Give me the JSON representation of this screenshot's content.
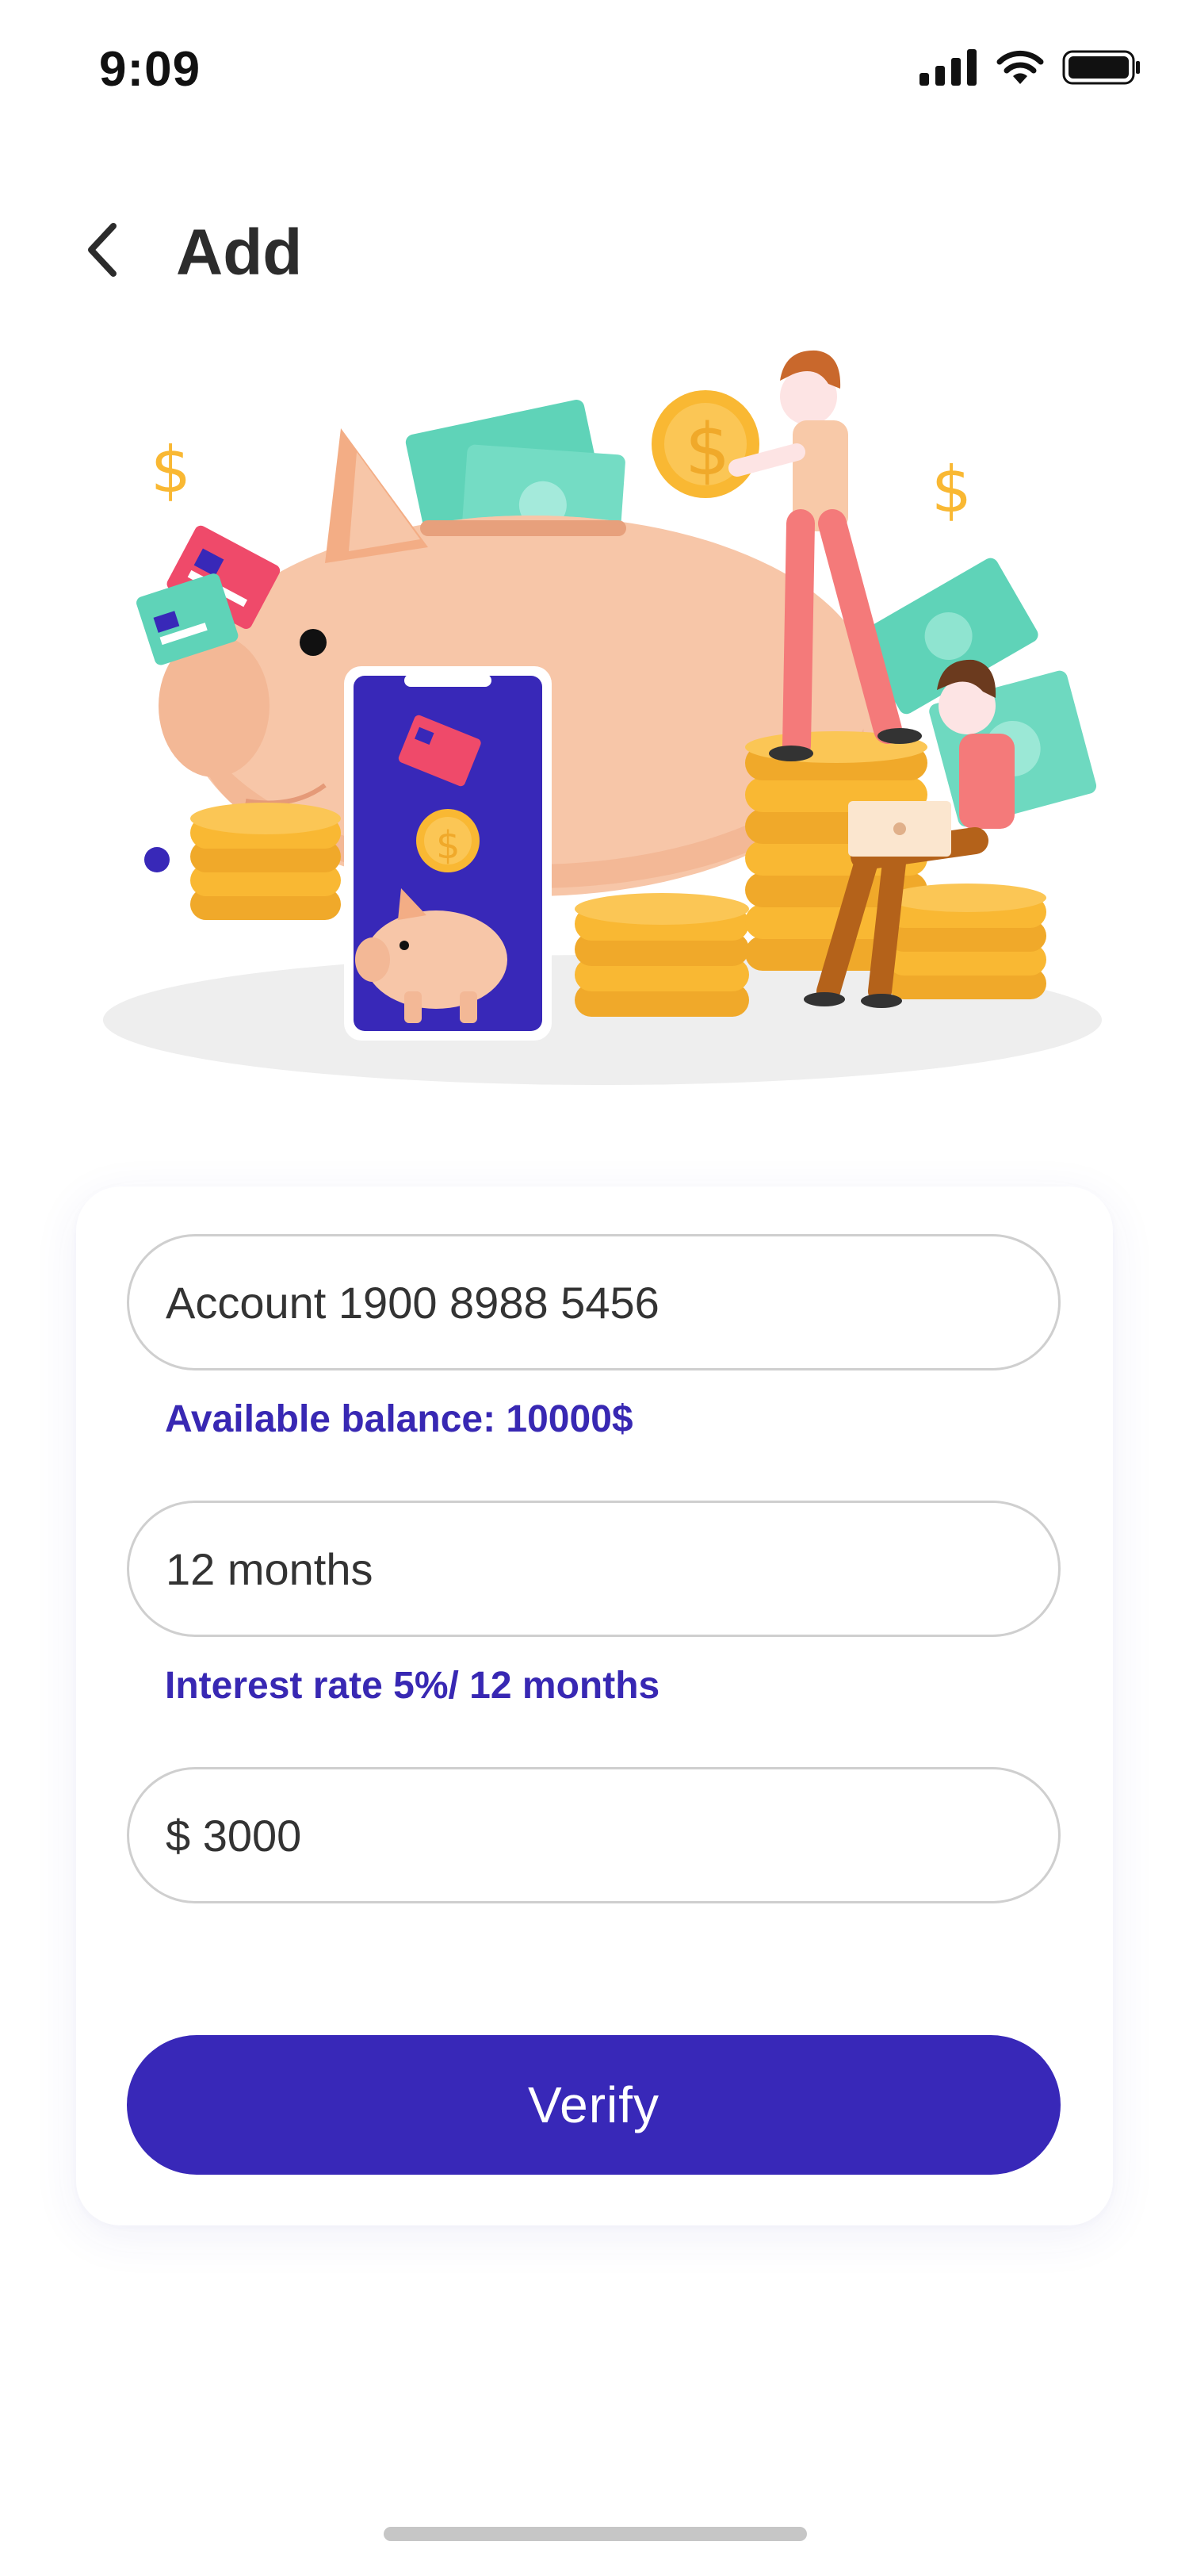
{
  "status_bar": {
    "time": "9:09"
  },
  "header": {
    "title": "Add",
    "back_icon": "chevron-left-icon"
  },
  "hero": {
    "description_icons": [
      "piggy-bank",
      "coins",
      "phone",
      "people"
    ]
  },
  "form": {
    "account_value": "Account 1900 8988 5456",
    "balance_hint": "Available balance: 10000$",
    "term_value": "12 months",
    "interest_hint": "Interest rate 5%/ 12 months",
    "amount_value": "$ 3000",
    "verify_label": "Verify"
  },
  "colors": {
    "accent": "#3828b8",
    "hint_text": "#3828b3",
    "field_border": "#cfcfcf",
    "pig": "#f7c6a8",
    "coin": "#f9b833",
    "money": "#5fd3b8",
    "card_red": "#ef4a6a"
  }
}
